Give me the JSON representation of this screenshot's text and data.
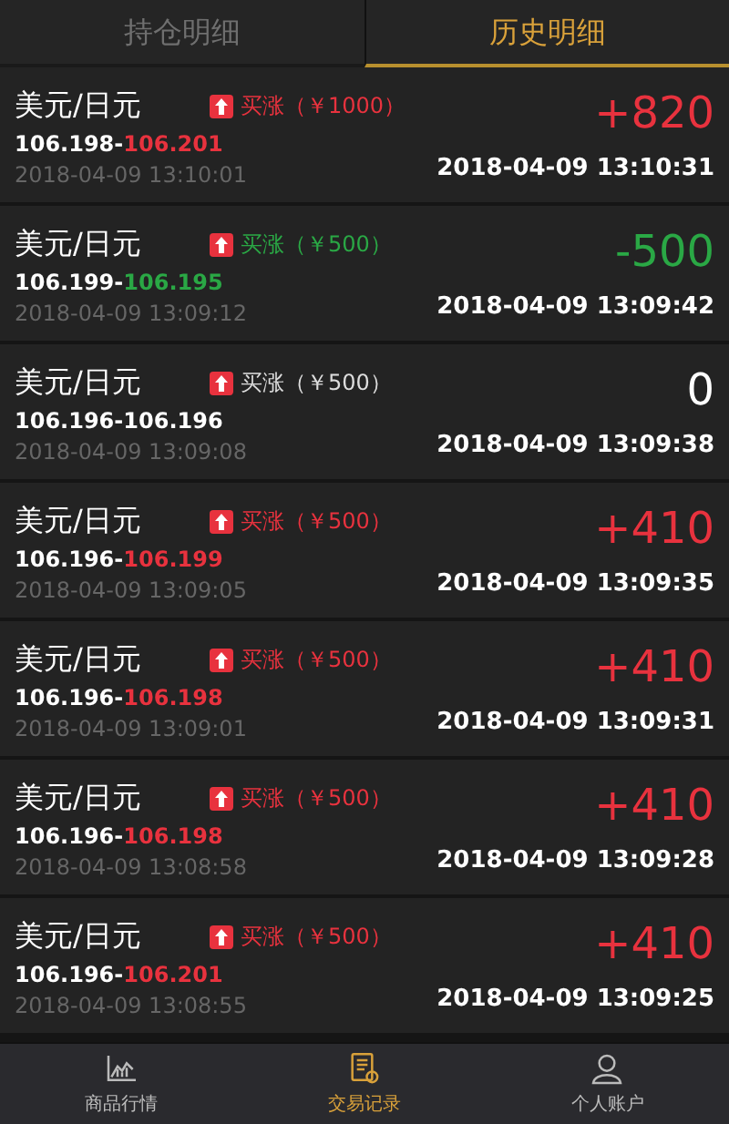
{
  "tabs": [
    {
      "label": "持仓明细",
      "selected": false
    },
    {
      "label": "历史明细",
      "selected": true
    }
  ],
  "records": [
    {
      "pair": "美元/日元",
      "order": "买涨（￥1000）",
      "kind": "profit",
      "open_price": "106.198-",
      "close_price": "106.201",
      "open_time": "2018-04-09 13:10:01",
      "result": "+820",
      "close_time": "2018-04-09 13:10:31"
    },
    {
      "pair": "美元/日元",
      "order": "买涨（￥500）",
      "kind": "loss",
      "open_price": "106.199-",
      "close_price": "106.195",
      "open_time": "2018-04-09 13:09:12",
      "result": "-500",
      "close_time": "2018-04-09 13:09:42"
    },
    {
      "pair": "美元/日元",
      "order": "买涨（￥500）",
      "kind": "flat",
      "open_price": "106.196-",
      "close_price": "106.196",
      "open_time": "2018-04-09 13:09:08",
      "result": "0",
      "close_time": "2018-04-09 13:09:38"
    },
    {
      "pair": "美元/日元",
      "order": "买涨（￥500）",
      "kind": "profit",
      "open_price": "106.196-",
      "close_price": "106.199",
      "open_time": "2018-04-09 13:09:05",
      "result": "+410",
      "close_time": "2018-04-09 13:09:35"
    },
    {
      "pair": "美元/日元",
      "order": "买涨（￥500）",
      "kind": "profit",
      "open_price": "106.196-",
      "close_price": "106.198",
      "open_time": "2018-04-09 13:09:01",
      "result": "+410",
      "close_time": "2018-04-09 13:09:31"
    },
    {
      "pair": "美元/日元",
      "order": "买涨（￥500）",
      "kind": "profit",
      "open_price": "106.196-",
      "close_price": "106.198",
      "open_time": "2018-04-09 13:08:58",
      "result": "+410",
      "close_time": "2018-04-09 13:09:28"
    },
    {
      "pair": "美元/日元",
      "order": "买涨（￥500）",
      "kind": "profit",
      "open_price": "106.196-",
      "close_price": "106.201",
      "open_time": "2018-04-09 13:08:55",
      "result": "+410",
      "close_time": "2018-04-09 13:09:25"
    }
  ],
  "nav": [
    {
      "label": "商品行情",
      "selected": false
    },
    {
      "label": "交易记录",
      "selected": true
    },
    {
      "label": "个人账户",
      "selected": false
    }
  ]
}
